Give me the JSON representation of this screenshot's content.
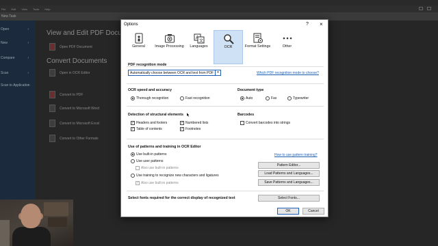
{
  "app": {
    "menu": [
      "File",
      "Edit",
      "View",
      "Tools",
      "Help"
    ],
    "tab": "New Task",
    "sidebar": [
      "Open",
      "New",
      "Compare",
      "Scan",
      "Scan to Application"
    ],
    "headings": {
      "view_edit": "View and Edit PDF Documents",
      "convert": "Convert Documents"
    },
    "items": {
      "open_pdf": "Open PDF Document",
      "open_ocr": "Open in OCR Editor",
      "convert_pdf": "Convert to PDF",
      "convert_word": "Convert to Microsoft Word",
      "convert_excel": "Convert to Microsoft Excel",
      "convert_other": "Convert to Other Formats"
    }
  },
  "dialog": {
    "title": "Options",
    "help": "?",
    "close": "×",
    "tabs": [
      {
        "label": "General",
        "icon": "general-icon"
      },
      {
        "label": "Image Processing",
        "icon": "camera-icon"
      },
      {
        "label": "Languages",
        "icon": "languages-icon"
      },
      {
        "label": "OCR",
        "icon": "magnifier-icon",
        "selected": true
      },
      {
        "label": "Format Settings",
        "icon": "format-settings-icon"
      },
      {
        "label": "Other",
        "icon": "more-icon"
      }
    ],
    "mode": {
      "title": "PDF recognition mode",
      "value": "Automatically choose between OCR and text from PDF",
      "help_link": "Which PDF recognition mode to choose?"
    },
    "speed": {
      "title": "OCR speed and accuracy",
      "thorough": "Thorough recognition",
      "fast": "Fast recognition"
    },
    "doctype": {
      "title": "Document type",
      "auto": "Auto",
      "fax": "Fax",
      "typewriter": "Typewriter"
    },
    "structure": {
      "title": "Detection of structural elements",
      "headers": "Headers and footers",
      "toc": "Table of contents",
      "numbered": "Numbered lists",
      "footnotes": "Footnotes"
    },
    "barcodes": {
      "title": "Barcodes",
      "convert": "Convert barcodes into strings"
    },
    "patterns": {
      "title": "Use of patterns and training in OCR Editor",
      "builtin": "Use built-in patterns",
      "user": "Use user patterns",
      "also1": "Also use built-in patterns",
      "training": "Use training to recognize new characters and ligatures",
      "also2": "Also use built-in patterns",
      "help_link": "How to use pattern training?",
      "editor_btn": "Pattern Editor...",
      "load_btn": "Load Patterns and Languages...",
      "save_btn": "Save Patterns and Languages..."
    },
    "fonts": {
      "title": "Select fonts required for the correct display of recognized text",
      "btn": "Select Fonts..."
    },
    "ok": "OK",
    "cancel": "Cancel"
  },
  "colors": {
    "accent": "#1a5fb4",
    "selected_tab": "#cfe2f5",
    "sidebar": "#1b2a3c"
  }
}
